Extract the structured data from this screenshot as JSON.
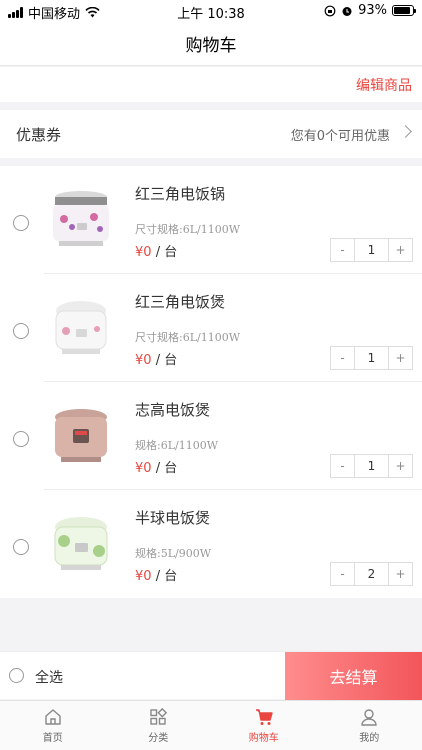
{
  "status_bar": {
    "carrier": "中国移动",
    "time": "上午 10:38",
    "battery": "93%"
  },
  "header": {
    "title": "购物车"
  },
  "edit": {
    "label": "编辑商品"
  },
  "coupon": {
    "label": "优惠券",
    "info": "您有0个可用优惠"
  },
  "cart": {
    "items": [
      {
        "name": "红三角电饭锅",
        "spec": "尺寸规格:6L/1100W",
        "price": "¥0",
        "unit": "/ 台",
        "qty": "1",
        "image_icon": "rice-cooker-floral"
      },
      {
        "name": "红三角电饭煲",
        "spec": "尺寸规格:6L/1100W",
        "price": "¥0",
        "unit": "/ 台",
        "qty": "1",
        "image_icon": "rice-cooker-white"
      },
      {
        "name": "志高电饭煲",
        "spec": "规格:6L/1100W",
        "price": "¥0",
        "unit": "/ 台",
        "qty": "1",
        "image_icon": "rice-cooker-pink"
      },
      {
        "name": "半球电饭煲",
        "spec": "规格:5L/900W",
        "price": "¥0",
        "unit": "/ 台",
        "qty": "2",
        "image_icon": "rice-cooker-green"
      }
    ],
    "minus": "-",
    "plus": "+"
  },
  "checkout": {
    "select_all": "全选",
    "button": "去结算"
  },
  "tabbar": {
    "items": [
      {
        "label": "首页",
        "icon": "home-icon"
      },
      {
        "label": "分类",
        "icon": "category-icon"
      },
      {
        "label": "购物车",
        "icon": "cart-icon",
        "active": true
      },
      {
        "label": "我的",
        "icon": "user-icon"
      }
    ]
  },
  "colors": {
    "accent": "#e8463f",
    "checkout_start": "#ff8d8d",
    "checkout_end": "#f2555a"
  }
}
